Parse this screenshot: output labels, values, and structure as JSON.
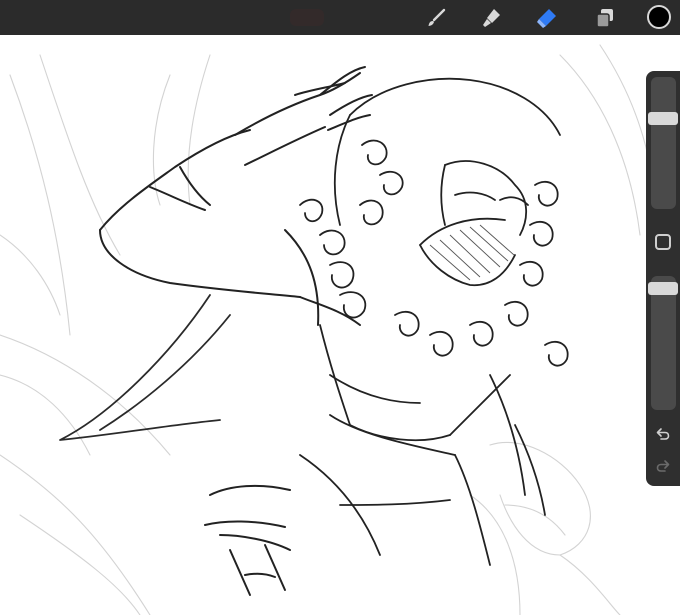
{
  "app": {
    "accent_color": "#2f7bf6"
  },
  "toolbar": {
    "tools": [
      {
        "name": "brush-icon",
        "active": false
      },
      {
        "name": "smudge-icon",
        "active": false
      },
      {
        "name": "eraser-icon",
        "active": true
      },
      {
        "name": "layers-icon",
        "active": false
      }
    ],
    "current_color": "#000000"
  },
  "sidebar": {
    "brush_size_level": 0.29,
    "opacity_level": 0.05,
    "undo_icon": "undo-icon",
    "redo_icon": "redo-icon",
    "modifier_icon": "square-modifier-icon"
  }
}
